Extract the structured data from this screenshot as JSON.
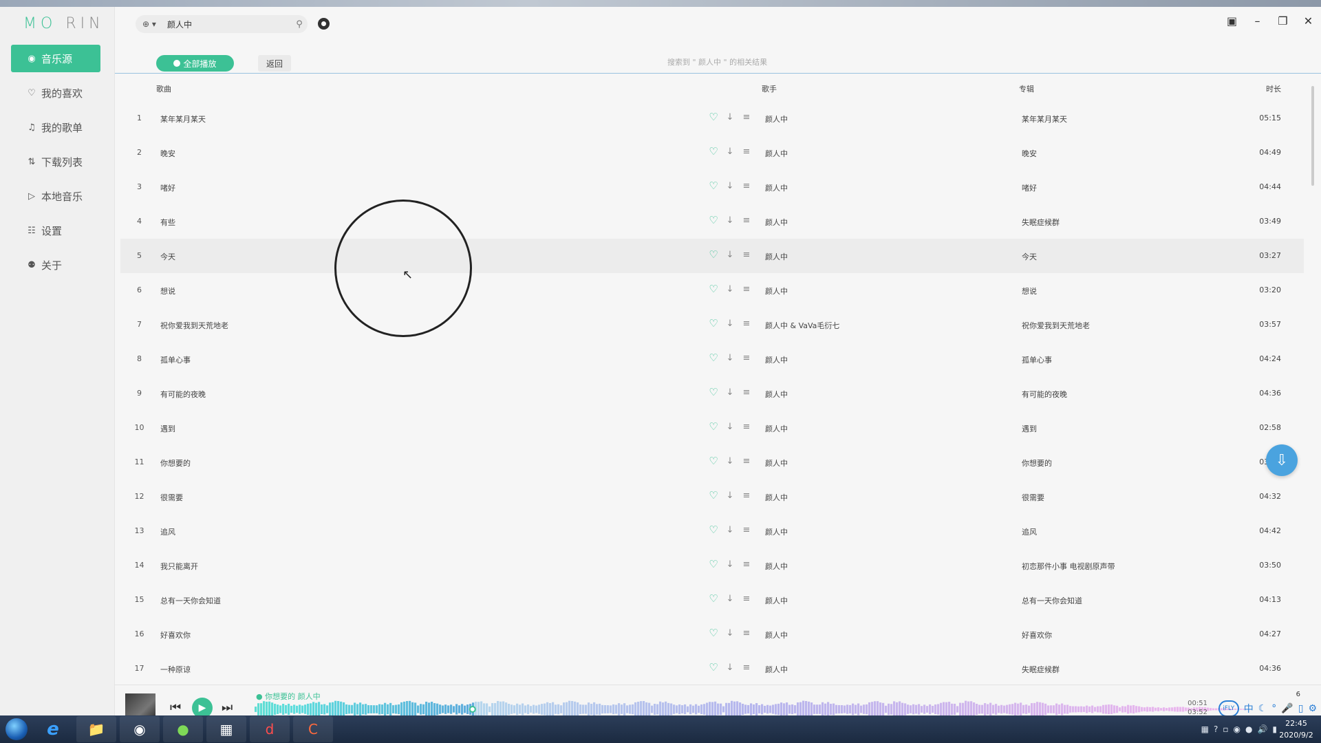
{
  "app": {
    "logo_left": "MO",
    "logo_right": "RIN"
  },
  "sidebar": {
    "items": [
      {
        "label": "音乐源",
        "icon": "disc-icon"
      },
      {
        "label": "我的喜欢",
        "icon": "heart-icon"
      },
      {
        "label": "我的歌单",
        "icon": "playlist-icon"
      },
      {
        "label": "下载列表",
        "icon": "download-list-icon"
      },
      {
        "label": "本地音乐",
        "icon": "local-music-icon"
      },
      {
        "label": "设置",
        "icon": "settings-icon"
      },
      {
        "label": "关于",
        "icon": "about-icon"
      }
    ]
  },
  "search": {
    "source_label": "⊕ ▾",
    "query": "颜人中"
  },
  "toolbar": {
    "play_all_label": "全部播放",
    "back_label": "返回",
    "result_info": "搜索到 \" 颜人中 \" 的相关结果"
  },
  "table": {
    "headers": {
      "song": "歌曲",
      "artist": "歌手",
      "album": "专辑",
      "duration": "时长"
    },
    "rows": [
      {
        "idx": "1",
        "title": "某年某月某天",
        "artist": "颜人中",
        "album": "某年某月某天",
        "dur": "05:15"
      },
      {
        "idx": "2",
        "title": "晚安",
        "artist": "颜人中",
        "album": "晚安",
        "dur": "04:49"
      },
      {
        "idx": "3",
        "title": "啫好",
        "artist": "颜人中",
        "album": "啫好",
        "dur": "04:44"
      },
      {
        "idx": "4",
        "title": "有些",
        "artist": "颜人中",
        "album": "失眠症候群",
        "dur": "03:49"
      },
      {
        "idx": "5",
        "title": "今天",
        "artist": "颜人中",
        "album": "今天",
        "dur": "03:27"
      },
      {
        "idx": "6",
        "title": "想说",
        "artist": "颜人中",
        "album": "想说",
        "dur": "03:20"
      },
      {
        "idx": "7",
        "title": "祝你爱我到天荒地老",
        "artist": "颜人中 & VaVa毛衍七",
        "album": "祝你爱我到天荒地老",
        "dur": "03:57"
      },
      {
        "idx": "8",
        "title": "孤单心事",
        "artist": "颜人中",
        "album": "孤单心事",
        "dur": "04:24"
      },
      {
        "idx": "9",
        "title": "有可能的夜晚",
        "artist": "颜人中",
        "album": "有可能的夜晚",
        "dur": "04:36"
      },
      {
        "idx": "10",
        "title": "遇到",
        "artist": "颜人中",
        "album": "遇到",
        "dur": "02:58"
      },
      {
        "idx": "11",
        "title": "你想要的",
        "artist": "颜人中",
        "album": "你想要的",
        "dur": "03:52"
      },
      {
        "idx": "12",
        "title": "很需要",
        "artist": "颜人中",
        "album": "很需要",
        "dur": "04:32"
      },
      {
        "idx": "13",
        "title": "追风",
        "artist": "颜人中",
        "album": "追风",
        "dur": "04:42"
      },
      {
        "idx": "14",
        "title": "我只能离开",
        "artist": "颜人中",
        "album": "初恋那件小事 电视剧原声带",
        "dur": "03:50"
      },
      {
        "idx": "15",
        "title": "总有一天你会知道",
        "artist": "颜人中",
        "album": "总有一天你会知道",
        "dur": "04:13"
      },
      {
        "idx": "16",
        "title": "好喜欢你",
        "artist": "颜人中",
        "album": "好喜欢你",
        "dur": "04:27"
      },
      {
        "idx": "17",
        "title": "一种原谅",
        "artist": "颜人中",
        "album": "失眠症候群",
        "dur": "04:36"
      }
    ]
  },
  "player": {
    "now_playing": "你想要的   颜人中",
    "elapsed": "00:51",
    "total": "03:52",
    "progress_fraction": 0.22,
    "volume_number": "6"
  },
  "ime": {
    "ifly": "iFLY",
    "lang": "中"
  },
  "taskbar": {
    "time": "22:45",
    "date": "2020/9/2"
  },
  "colors": {
    "accent": "#3cc195",
    "link_blue": "#4aa3df"
  }
}
